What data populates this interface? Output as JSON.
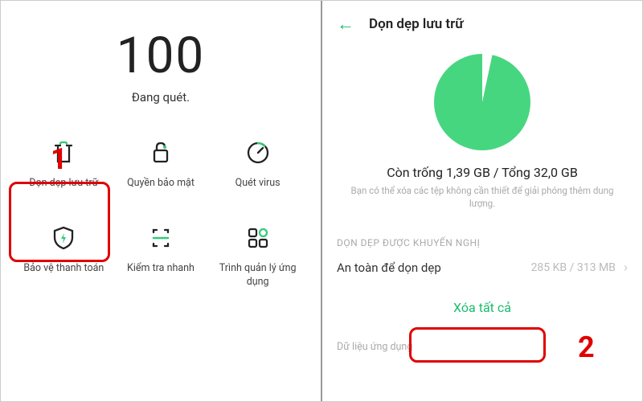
{
  "left": {
    "score": "100",
    "status": "Đang quét.",
    "step_badge": "1",
    "grid": [
      {
        "icon": "trash",
        "label": "Dọn dẹp lưu trữ"
      },
      {
        "icon": "lock",
        "label": "Quyền bảo mật"
      },
      {
        "icon": "gauge",
        "label": "Quét virus"
      },
      {
        "icon": "shield",
        "label": "Bảo vệ thanh toán"
      },
      {
        "icon": "scan",
        "label": "Kiểm tra nhanh"
      },
      {
        "icon": "apps",
        "label": "Trình quản lý ứng dụng"
      }
    ]
  },
  "right": {
    "title": "Dọn dẹp lưu trữ",
    "storage_line": "Còn trống 1,39 GB / Tổng 32,0 GB",
    "storage_hint": "Bạn có thể xóa các tệp không cần thiết để giải phóng thêm dung lượng.",
    "section_label": "DỌN DẸP ĐƯỢC KHUYẾN NGHỊ",
    "safe_row": {
      "title": "An toàn để dọn dẹp",
      "detail": "285 KB / 313 MB"
    },
    "delete_all": "Xóa tất cả",
    "app_data_label": "Dữ liệu ứng dụng",
    "step_badge": "2"
  },
  "colors": {
    "accent": "#1abc6d",
    "danger": "#e00000"
  }
}
